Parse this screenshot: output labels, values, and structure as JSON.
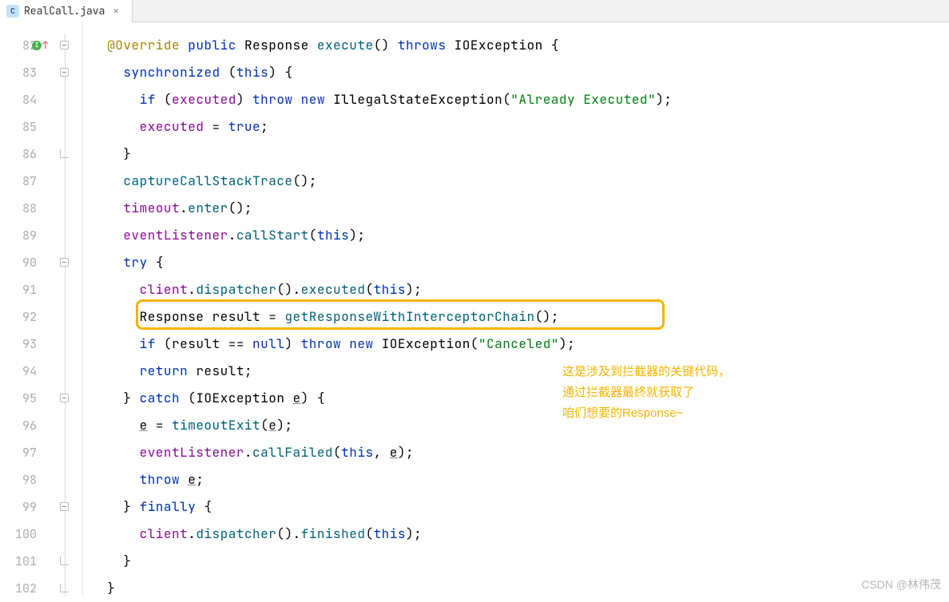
{
  "tab": {
    "icon_letter": "C",
    "filename": "RealCall.java"
  },
  "lines": {
    "start": 82,
    "end": 102
  },
  "code": {
    "l82": {
      "ann": "@Override",
      "kw1": "public",
      "type": "Response",
      "method": "execute",
      "kw2": "throws",
      "exc": "IOException",
      "brace": " {"
    },
    "l83": {
      "kw": "synchronized",
      "arg": "this",
      "brace": ") {"
    },
    "l84": {
      "kw1": "if",
      "field": "executed",
      "kw2": "throw",
      "kw3": "new",
      "exc": "IllegalStateException",
      "str": "\"Already Executed\""
    },
    "l85": {
      "field": "executed",
      "kw": "true"
    },
    "l86": {
      "brace": "}"
    },
    "l87": {
      "method": "captureCallStackTrace"
    },
    "l88": {
      "field": "timeout",
      "method": "enter"
    },
    "l89": {
      "field": "eventListener",
      "method": "callStart",
      "arg": "this"
    },
    "l90": {
      "kw": "try",
      "brace": " {"
    },
    "l91": {
      "field": "client",
      "m1": "dispatcher",
      "m2": "executed",
      "arg": "this"
    },
    "l92": {
      "type": "Response",
      "var": "result",
      "method": "getResponseWithInterceptorChain"
    },
    "l93": {
      "kw1": "if",
      "var": "result",
      "kw2": "null",
      "kw3": "throw",
      "kw4": "new",
      "exc": "IOException",
      "str": "\"Canceled\""
    },
    "l94": {
      "kw": "return",
      "var": "result"
    },
    "l95": {
      "kw": "catch",
      "type": "IOException",
      "var": "e",
      "brace": ") {"
    },
    "l96": {
      "var": "e",
      "method": "timeoutExit",
      "arg": "e"
    },
    "l97": {
      "field": "eventListener",
      "method": "callFailed",
      "arg1": "this",
      "arg2": "e"
    },
    "l98": {
      "kw": "throw",
      "var": "e"
    },
    "l99": {
      "kw": "finally",
      "brace": " {"
    },
    "l100": {
      "field": "client",
      "m1": "dispatcher",
      "m2": "finished",
      "arg": "this"
    },
    "l101": {
      "brace": "}"
    },
    "l102": {
      "brace": "}"
    }
  },
  "annotation": {
    "line1": "这是涉及到拦截器的关键代码，",
    "line2": "通过拦截器最终就获取了",
    "line3": "咱们想要的Response~"
  },
  "watermark": "CSDN @林伟茂"
}
